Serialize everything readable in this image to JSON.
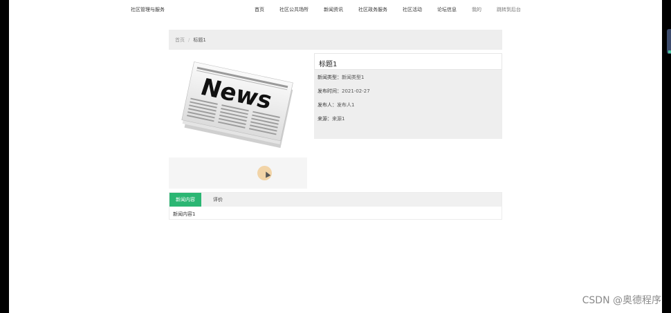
{
  "header": {
    "brand": "社区管理与服务",
    "nav": [
      "首页",
      "社区公共场所",
      "新闻资讯",
      "社区政务服务",
      "社区活动",
      "论坛信息",
      "我的",
      "跳转到后台"
    ]
  },
  "breadcrumb": {
    "home": "首页",
    "separator": "/",
    "current": "标题1"
  },
  "article": {
    "image_alt": "News",
    "title": "标题1",
    "fields": [
      {
        "label": "新闻类型：",
        "value": "新闻类型1"
      },
      {
        "label": "发布时间：",
        "value": "2021-02-27"
      },
      {
        "label": "发布人：",
        "value": "发布人1"
      },
      {
        "label": "来源：",
        "value": "来源1"
      }
    ]
  },
  "tabs": {
    "items": [
      "新闻内容",
      "评价"
    ],
    "active_index": 0,
    "content": "新闻内容1"
  },
  "watermark": "CSDN @奥德程序",
  "colors": {
    "accent": "#2bb673",
    "panel": "#eeeeee"
  }
}
